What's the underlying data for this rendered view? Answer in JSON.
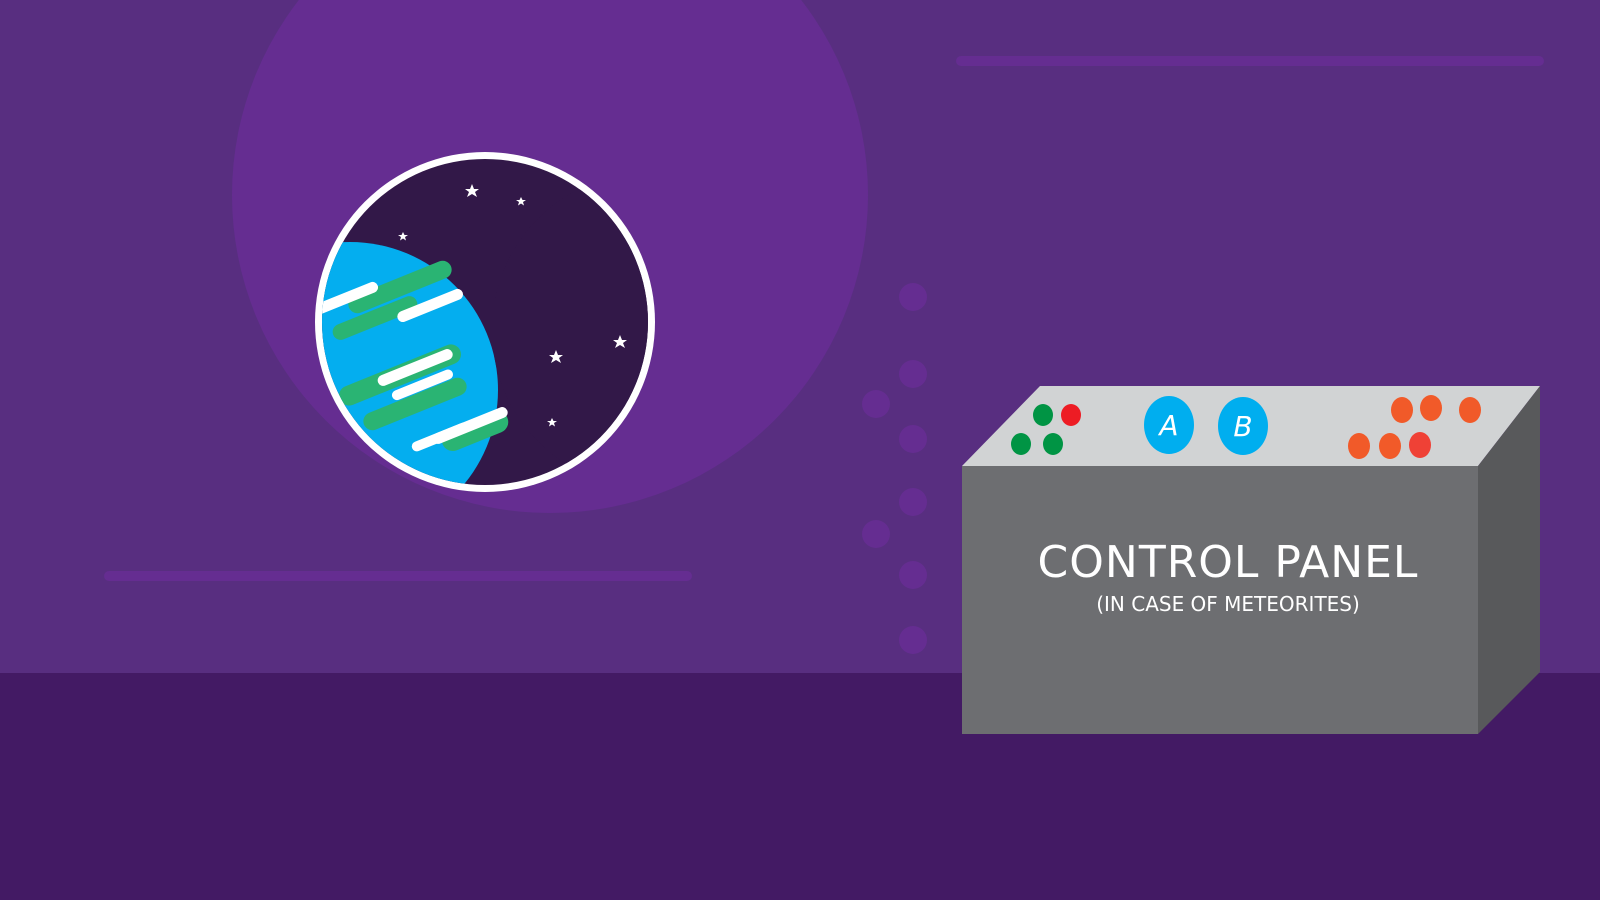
{
  "colors": {
    "wall": "#582e80",
    "floor": "#431a64",
    "halo": "#652d91",
    "space": "#321848",
    "ocean": "#04aeef",
    "land": "#2ab473",
    "panel_top": "#d1d3d4",
    "panel_front": "#6d6e71",
    "panel_side": "#58595b",
    "button_blue": "#00aeef",
    "led_green": "#009444",
    "led_red": "#ed1c24",
    "led_orange": "#f15a29"
  },
  "control_panel": {
    "title": "CONTROL PANEL",
    "subtitle": "(IN CASE OF METEORITES)",
    "button_a": "A",
    "button_b": "B"
  },
  "icons": {
    "window": "porthole-window-icon",
    "planet": "earth-planet-icon",
    "star": "star-icon"
  }
}
